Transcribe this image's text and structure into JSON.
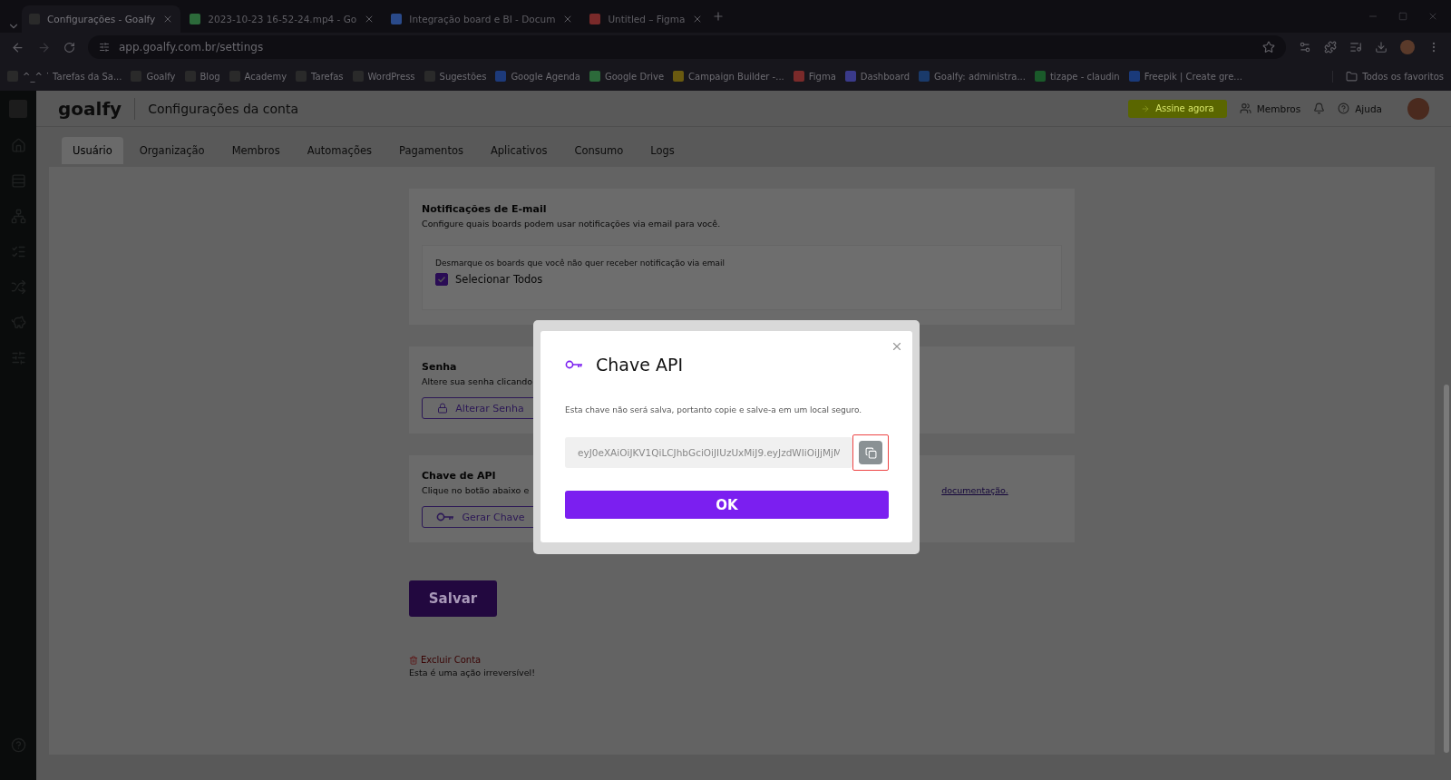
{
  "browser": {
    "tabs": [
      {
        "title": "Configurações - Goalfy",
        "selected": true
      },
      {
        "title": "2023-10-23 16-52-24.mp4 - Go",
        "selected": false
      },
      {
        "title": "Integração board e BI - Docum",
        "selected": false
      },
      {
        "title": "Untitled – Figma",
        "selected": false
      }
    ],
    "address": "app.goalfy.com.br/settings",
    "bookmarks": [
      "^_^ ˙ Tarefas da Sa...",
      "Goalfy",
      "Blog",
      "Academy",
      "Tarefas",
      "WordPress",
      "Sugestões",
      "Google Agenda",
      "Google Drive",
      "Campaign Builder -...",
      "Figma",
      "Dashboard",
      "Goalfy: administra...",
      "tizape - claudin",
      "Freepik | Create gre..."
    ],
    "all_bookmarks": "Todos os favoritos"
  },
  "header": {
    "logo": "goalfy",
    "title": "Configurações da conta",
    "subscribe": "Assine agora",
    "members": "Membros",
    "help": "Ajuda"
  },
  "settings_tabs": [
    {
      "label": "Usuário",
      "selected": true
    },
    {
      "label": "Organização",
      "selected": false
    },
    {
      "label": "Membros",
      "selected": false
    },
    {
      "label": "Automações",
      "selected": false
    },
    {
      "label": "Pagamentos",
      "selected": false
    },
    {
      "label": "Aplicativos",
      "selected": false
    },
    {
      "label": "Consumo",
      "selected": false
    },
    {
      "label": "Logs",
      "selected": false
    }
  ],
  "email_notifications": {
    "title": "Notificações de E-mail",
    "description": "Configure quais boards podem usar notificações via email para você.",
    "hint": "Desmarque os boards que você não quer receber notificação via email",
    "select_all": {
      "label": "Selecionar Todos",
      "checked": true
    }
  },
  "password": {
    "title": "Senha",
    "description": "Altere sua senha clicando",
    "button": "Alterar Senha"
  },
  "api_key": {
    "title": "Chave de API",
    "description": "Clique no botão abaixo e",
    "link": "documentação.",
    "button": "Gerar Chave"
  },
  "save": "Salvar",
  "delete_account": {
    "label": "Excluir Conta",
    "warning": "Esta é uma ação irreversível!"
  },
  "modal": {
    "title": "Chave API",
    "note": "Esta chave não será salva, portanto copie e salve-a em um local seguro.",
    "key": "eyJ0eXAiOiJKV1QiLCJhbGciOiJIUzUxMiJ9.eyJzdWIiOiJjMjM",
    "copy_highlighted": true,
    "ok": "OK"
  }
}
